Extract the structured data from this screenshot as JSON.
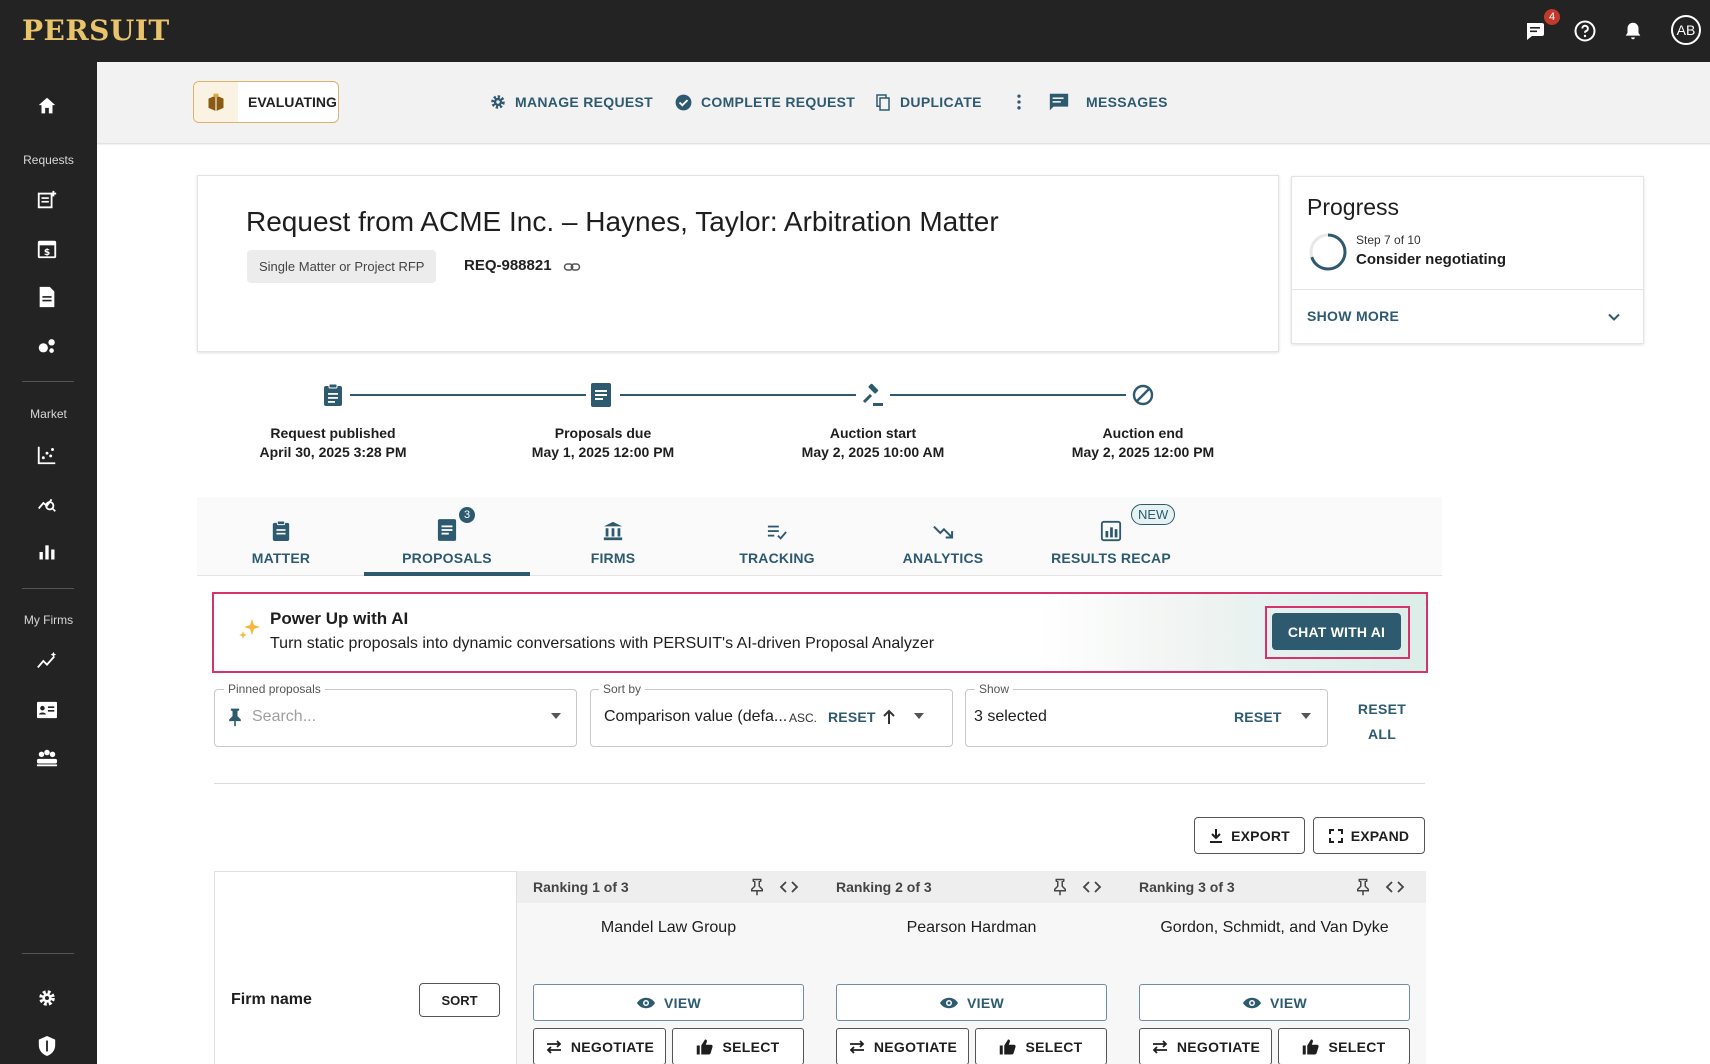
{
  "app": {
    "logo": "PERSUIT",
    "avatar_initials": "AB",
    "messages_badge": "4"
  },
  "sidebar": {
    "sections": {
      "requests": "Requests",
      "market": "Market",
      "my_firms": "My Firms"
    }
  },
  "actions": {
    "status": "EVALUATING",
    "manage": "MANAGE REQUEST",
    "complete": "COMPLETE REQUEST",
    "duplicate": "DUPLICATE",
    "messages": "MESSAGES"
  },
  "request": {
    "title": "Request from ACME Inc. – Haynes, Taylor: Arbitration Matter",
    "type": "Single Matter or Project RFP",
    "id": "REQ-988821"
  },
  "progress": {
    "title": "Progress",
    "step": "Step 7 of 10",
    "stage": "Consider negotiating",
    "show_more": "SHOW MORE",
    "fraction": 0.7
  },
  "timeline": [
    {
      "label": "Request published",
      "date": "April 30, 2025 3:28 PM"
    },
    {
      "label": "Proposals due",
      "date": "May 1, 2025 12:00 PM"
    },
    {
      "label": "Auction start",
      "date": "May 2, 2025 10:00 AM"
    },
    {
      "label": "Auction end",
      "date": "May 2, 2025 12:00 PM"
    }
  ],
  "tabs": [
    {
      "label": "MATTER"
    },
    {
      "label": "PROPOSALS",
      "badge": "3",
      "active": true
    },
    {
      "label": "FIRMS"
    },
    {
      "label": "TRACKING"
    },
    {
      "label": "ANALYTICS"
    },
    {
      "label": "RESULTS RECAP",
      "badge": "NEW"
    }
  ],
  "ai_banner": {
    "title": "Power Up with AI",
    "description": "Turn static proposals into dynamic conversations with PERSUIT's AI-driven Proposal Analyzer",
    "button": "CHAT WITH AI"
  },
  "filters": {
    "pinned": {
      "label": "Pinned proposals",
      "placeholder": "Search..."
    },
    "sort": {
      "label": "Sort by",
      "value": "Comparison value (defa...",
      "order": "ASC.",
      "reset": "RESET"
    },
    "show": {
      "label": "Show",
      "value": "3 selected",
      "reset": "RESET"
    },
    "reset_all_1": "RESET",
    "reset_all_2": "ALL"
  },
  "table_actions": {
    "export": "EXPORT",
    "expand": "EXPAND"
  },
  "comparison": {
    "row_label": "Firm name",
    "sort_button": "SORT",
    "columns": [
      {
        "ranking": "Ranking 1 of 3",
        "firm": "Mandel Law Group"
      },
      {
        "ranking": "Ranking 2 of 3",
        "firm": "Pearson Hardman"
      },
      {
        "ranking": "Ranking 3 of 3",
        "firm": "Gordon, Schmidt, and Van Dyke"
      }
    ],
    "view": "VIEW",
    "negotiate": "NEGOTIATE",
    "select": "SELECT"
  },
  "colors": {
    "primary": "#2e5a70",
    "dark": "#232323",
    "highlight": "#d6336c",
    "gold": "#e9c46a"
  }
}
